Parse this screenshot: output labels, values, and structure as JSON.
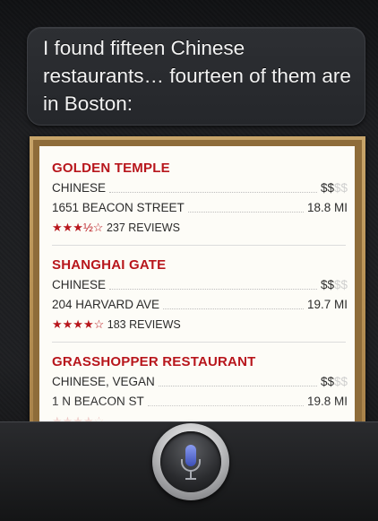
{
  "assistant": {
    "response": "I found fifteen Chinese restaurants… fourteen of them are in Boston:"
  },
  "restaurants": [
    {
      "name": "GOLDEN TEMPLE",
      "cuisine": "CHINESE",
      "price_on": "$$",
      "price_off": "$$",
      "address": "1651 BEACON STREET",
      "distance": "18.8 MI",
      "stars": "★★★½☆",
      "reviews": "237 REVIEWS"
    },
    {
      "name": "SHANGHAI GATE",
      "cuisine": "CHINESE",
      "price_on": "$$",
      "price_off": "$$",
      "address": "204 HARVARD AVE",
      "distance": "19.7 MI",
      "stars": "★★★★☆",
      "reviews": "183 REVIEWS"
    },
    {
      "name": "GRASSHOPPER RESTAURANT",
      "cuisine": "CHINESE, VEGAN",
      "price_on": "$$",
      "price_off": "$$",
      "address": "1 N BEACON ST",
      "distance": "19.8 MI",
      "stars": "★★★★☆"
    }
  ],
  "icons": {
    "mic": "microphone-icon"
  },
  "colors": {
    "accent_red": "#b8161c",
    "mic_blue": "#5a6fd1"
  }
}
